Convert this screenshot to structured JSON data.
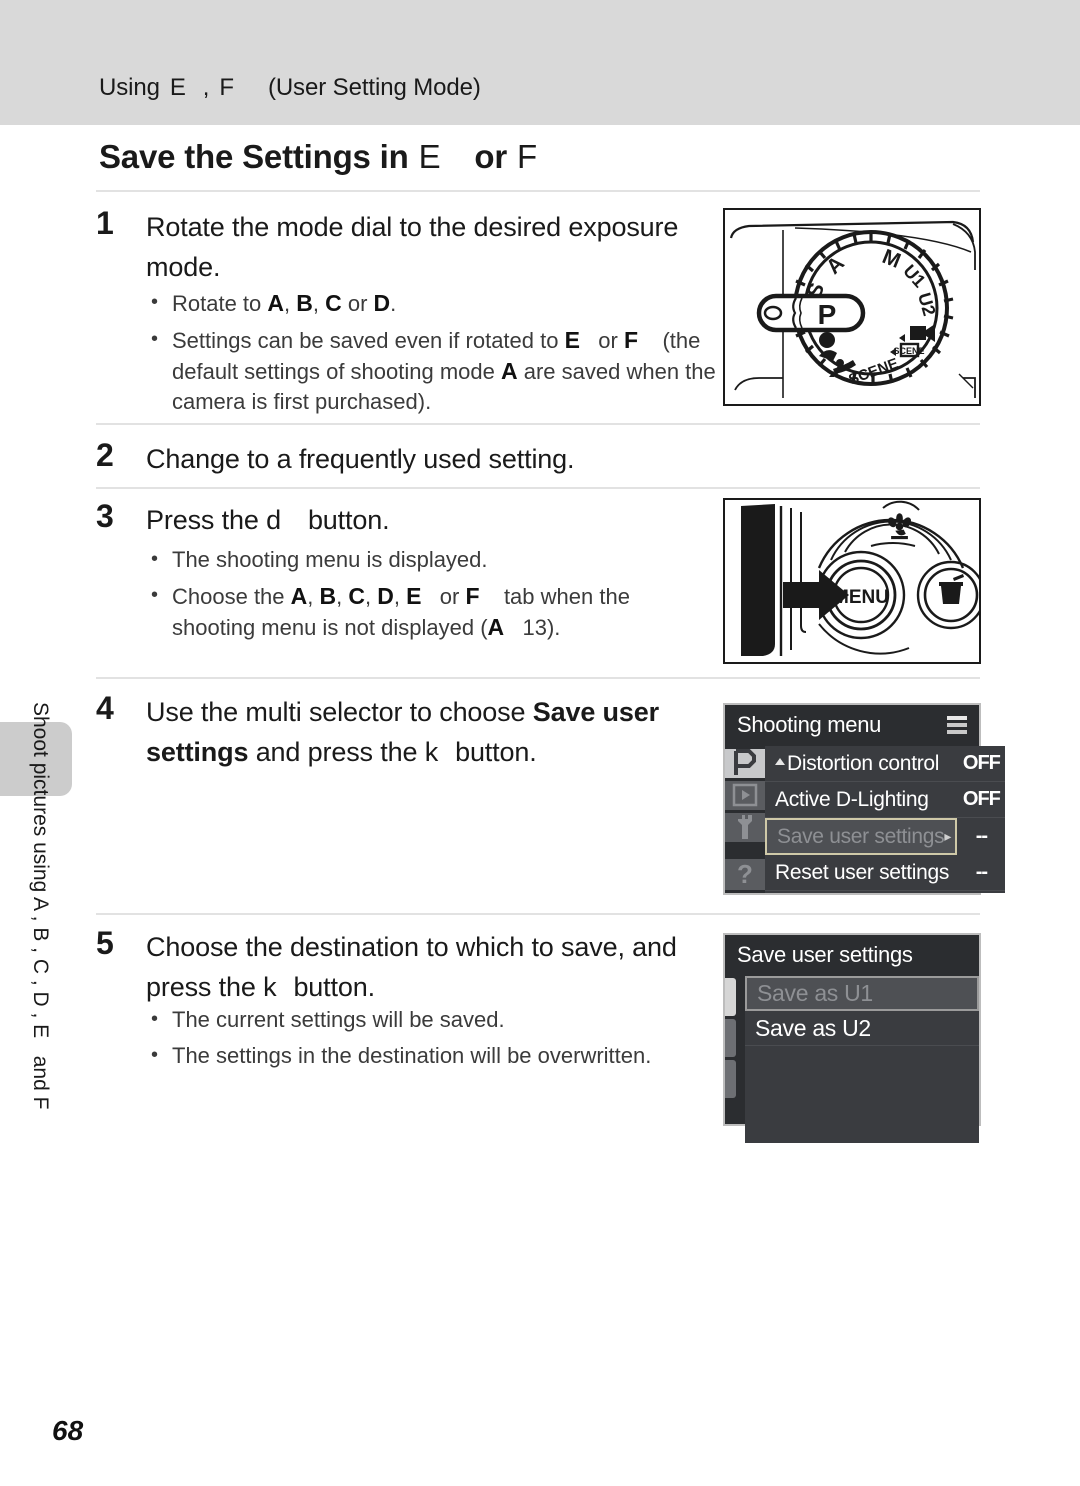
{
  "header": {
    "running_head_prefix": "Using",
    "running_head_sym1": "E",
    "running_head_comma": ",",
    "running_head_sym2": "F",
    "running_head_suffix": "(User Setting Mode)"
  },
  "title": {
    "part1": "Save the Settings in",
    "sym1": "E",
    "part2": "or",
    "sym2": "F"
  },
  "steps": [
    {
      "num": "1",
      "heading": "Rotate the mode dial to the desired exposure mode.",
      "bullets": [
        "Rotate to A, B, C or D.",
        "Settings can be saved even if rotated to E or F (the default settings of shooting mode A are saved when the camera is first purchased)."
      ]
    },
    {
      "num": "2",
      "heading": "Change to a frequently used setting.",
      "bullets": []
    },
    {
      "num": "3",
      "heading_pre": "Press the",
      "heading_sym": "d",
      "heading_post": "button.",
      "num3": "3",
      "bullets": [
        "The shooting menu is displayed.",
        "Choose the A, B, C, D, E or F tab when the shooting menu is not displayed (A 13)."
      ]
    },
    {
      "num": "4",
      "heading_pre": "Use the multi selector to choose",
      "heading_bold": "Save user settings",
      "heading_mid": "and press the",
      "heading_sym": "k",
      "heading_post": "button.",
      "bullets": []
    },
    {
      "num": "5",
      "heading_pre": "Choose the destination to which to save, and press the",
      "heading_sym": "k",
      "heading_post": "button.",
      "bullets": [
        "The current settings will be saved.",
        "The settings in the destination will be overwritten."
      ]
    }
  ],
  "mode_dial": {
    "labels": [
      "P",
      "S",
      "A",
      "M",
      "U1",
      "U2",
      "SCENE"
    ],
    "selected": "P"
  },
  "menu_button_illustration": {
    "menu_label": "MENU",
    "delete_icon": "trash-icon",
    "macro_icon": "macro-flower-icon"
  },
  "shooting_menu": {
    "title": "Shooting menu",
    "tabs": [
      {
        "name": "shooting-tab",
        "glyph": "P",
        "active": true
      },
      {
        "name": "playback-tab",
        "glyph": "▶",
        "active": false
      },
      {
        "name": "setup-tab",
        "glyph": "Y",
        "active": false
      },
      {
        "name": "help-tab",
        "glyph": "?",
        "active": false
      }
    ],
    "rows": [
      {
        "label": "Distortion control",
        "value": "OFF",
        "selected": false,
        "up_marker": true
      },
      {
        "label": "Active D-Lighting",
        "value": "OFF",
        "selected": false,
        "up_marker": false
      },
      {
        "label": "Save user settings",
        "value": "--",
        "selected": true,
        "up_marker": false
      },
      {
        "label": "Reset user settings",
        "value": "--",
        "selected": false,
        "up_marker": false
      }
    ]
  },
  "save_dialog": {
    "title": "Save user settings",
    "rows": [
      {
        "label": "Save as U1",
        "selected": true
      },
      {
        "label": "Save as U2",
        "selected": false
      }
    ]
  },
  "sidebar": {
    "text_pre": "Shoot pictures using",
    "text_syms": "A , B , C , D , E",
    "text_post": "and F"
  },
  "folio": {
    "page_number": "68"
  },
  "colors": {
    "header_band": "#d9d9d9",
    "rule": "#e2e2e2",
    "side_tab": "#cccccc",
    "lcd_bg": "#2b2d30",
    "lcd_row": "#3a3c40",
    "lcd_selected_border": "#cfc9a8"
  }
}
